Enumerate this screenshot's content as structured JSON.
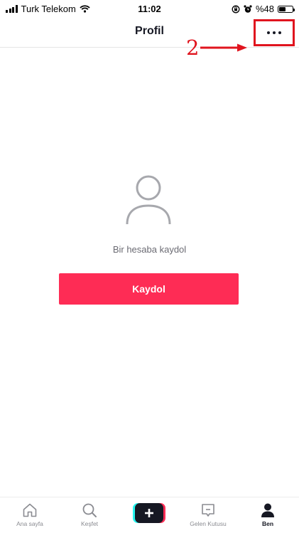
{
  "status_bar": {
    "carrier": "Turk Telekom",
    "time": "11:02",
    "battery": "%48",
    "battery_level": 0.48
  },
  "header": {
    "title": "Profil",
    "more_icon": "more-dots-icon"
  },
  "annotation": {
    "step_number": "2",
    "color": "#e0141e"
  },
  "main": {
    "avatar_icon": "user-outline-icon",
    "prompt": "Bir hesaba kaydol",
    "signup_label": "Kaydol",
    "accent_color": "#fe2c55"
  },
  "bottom_nav": {
    "items": [
      {
        "label": "Ana sayfa",
        "icon": "home-icon",
        "active": false
      },
      {
        "label": "Keşfet",
        "icon": "search-icon",
        "active": false
      },
      {
        "label": "",
        "icon": "create-plus-icon",
        "active": false
      },
      {
        "label": "Gelen Kutusu",
        "icon": "inbox-icon",
        "active": false
      },
      {
        "label": "Ben",
        "icon": "profile-icon",
        "active": true
      }
    ]
  }
}
